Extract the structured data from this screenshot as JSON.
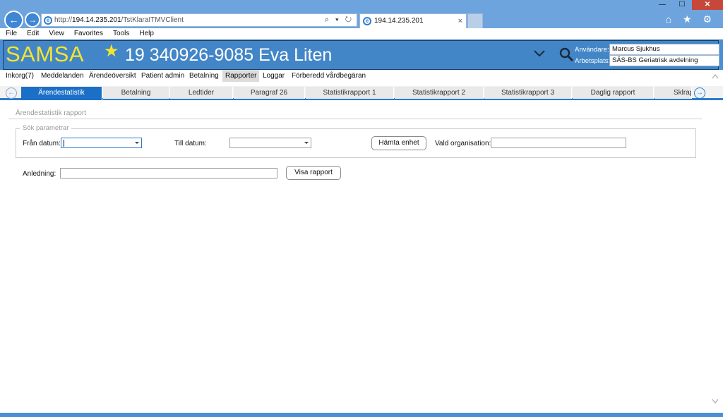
{
  "browser": {
    "address_scheme": "http://",
    "address_host": "194.14.235.201",
    "address_path": "/TstKlaraITMVClient",
    "tab_title": "194.14.235.201",
    "tab_close": "×",
    "address_tools": "⌕ ▾ ↻",
    "back": "←",
    "forward": "→",
    "minimize": "—",
    "maximize": "☐",
    "close": "✕",
    "right_icons": "⌂ ★ ⚙"
  },
  "menubar": [
    "File",
    "Edit",
    "View",
    "Favorites",
    "Tools",
    "Help"
  ],
  "header": {
    "brand": "SAMSA",
    "patient": "19 340926-9085 Eva Liten",
    "user_label": "Användare:",
    "user_value": "Marcus Sjukhus",
    "workplace_label": "Arbetsplats:",
    "workplace_value": "SÄS-BS Geriatrisk avdelning",
    "colors": {
      "header_bg": "#4386c7",
      "brand": "#f5e52c"
    }
  },
  "main_menu": [
    "Inkorg(7)",
    "Meddelanden",
    "Ärendeöversikt",
    "Patient admin",
    "Betalning",
    "Rapporter",
    "Loggar",
    "Förberedd vårdbegäran"
  ],
  "main_menu_active": "Rapporter",
  "subtabs": [
    "Ärendestatistik",
    "Betalning",
    "Ledtider",
    "Paragraf 26",
    "Statistikrapport 1",
    "Statistikrapport 2",
    "Statistikrapport 3",
    "Daglig rapport",
    "Sklrap"
  ],
  "subtab_active": "Ärendestatistik",
  "report": {
    "title": "Ärendestatistik rapport",
    "legend": "Sök parametrar",
    "from_label": "Från datum:",
    "to_label": "Till datum:",
    "fetch_button": "Hämta enhet",
    "org_label": "Vald organisation:",
    "reason_label": "Anledning:",
    "show_button": "Visa rapport",
    "from_value": "",
    "to_value": "",
    "org_value": "",
    "reason_value": ""
  }
}
